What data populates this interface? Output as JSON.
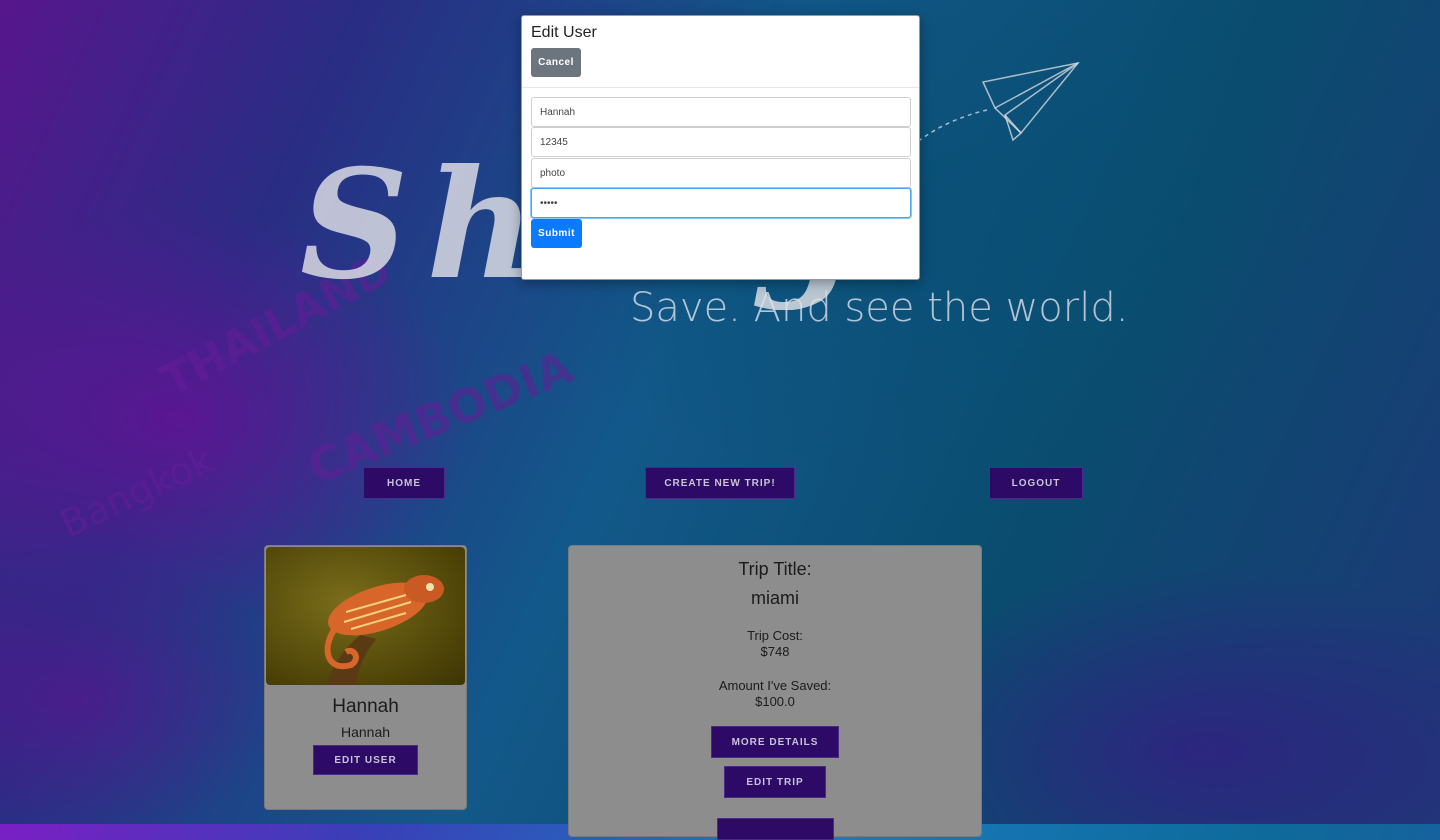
{
  "hero": {
    "script_logo": "Sh      ng",
    "tagline": "Save. And see the world."
  },
  "map_labels": [
    "THAILAND",
    "CAMBODIA",
    "Bangkok"
  ],
  "nav": {
    "home_label": "HOME",
    "create_trip_label": "CREATE NEW TRIP!",
    "logout_label": "LOGOUT"
  },
  "profile": {
    "name": "Hannah",
    "username": "Hannah",
    "edit_user_label": "EDIT USER"
  },
  "trip": {
    "title_label": "Trip Title:",
    "title_value": "miami",
    "cost_label": "Trip Cost:",
    "cost_value": "$748",
    "saved_label": "Amount I've Saved:",
    "saved_value": "$100.0",
    "more_details_label": "MORE DETAILS",
    "edit_trip_label": "EDIT TRIP"
  },
  "modal": {
    "title": "Edit User",
    "cancel_label": "Cancel",
    "fields": [
      {
        "value": "Hannah"
      },
      {
        "value": "12345"
      },
      {
        "value": "photo"
      },
      {
        "value": "•••••"
      }
    ],
    "submit_label": "Submit"
  },
  "colors": {
    "nav_button": "#2c0a66",
    "submit_button": "#0a7bff",
    "cancel_button": "#6c757d",
    "card_background": "#8d8d8d"
  }
}
